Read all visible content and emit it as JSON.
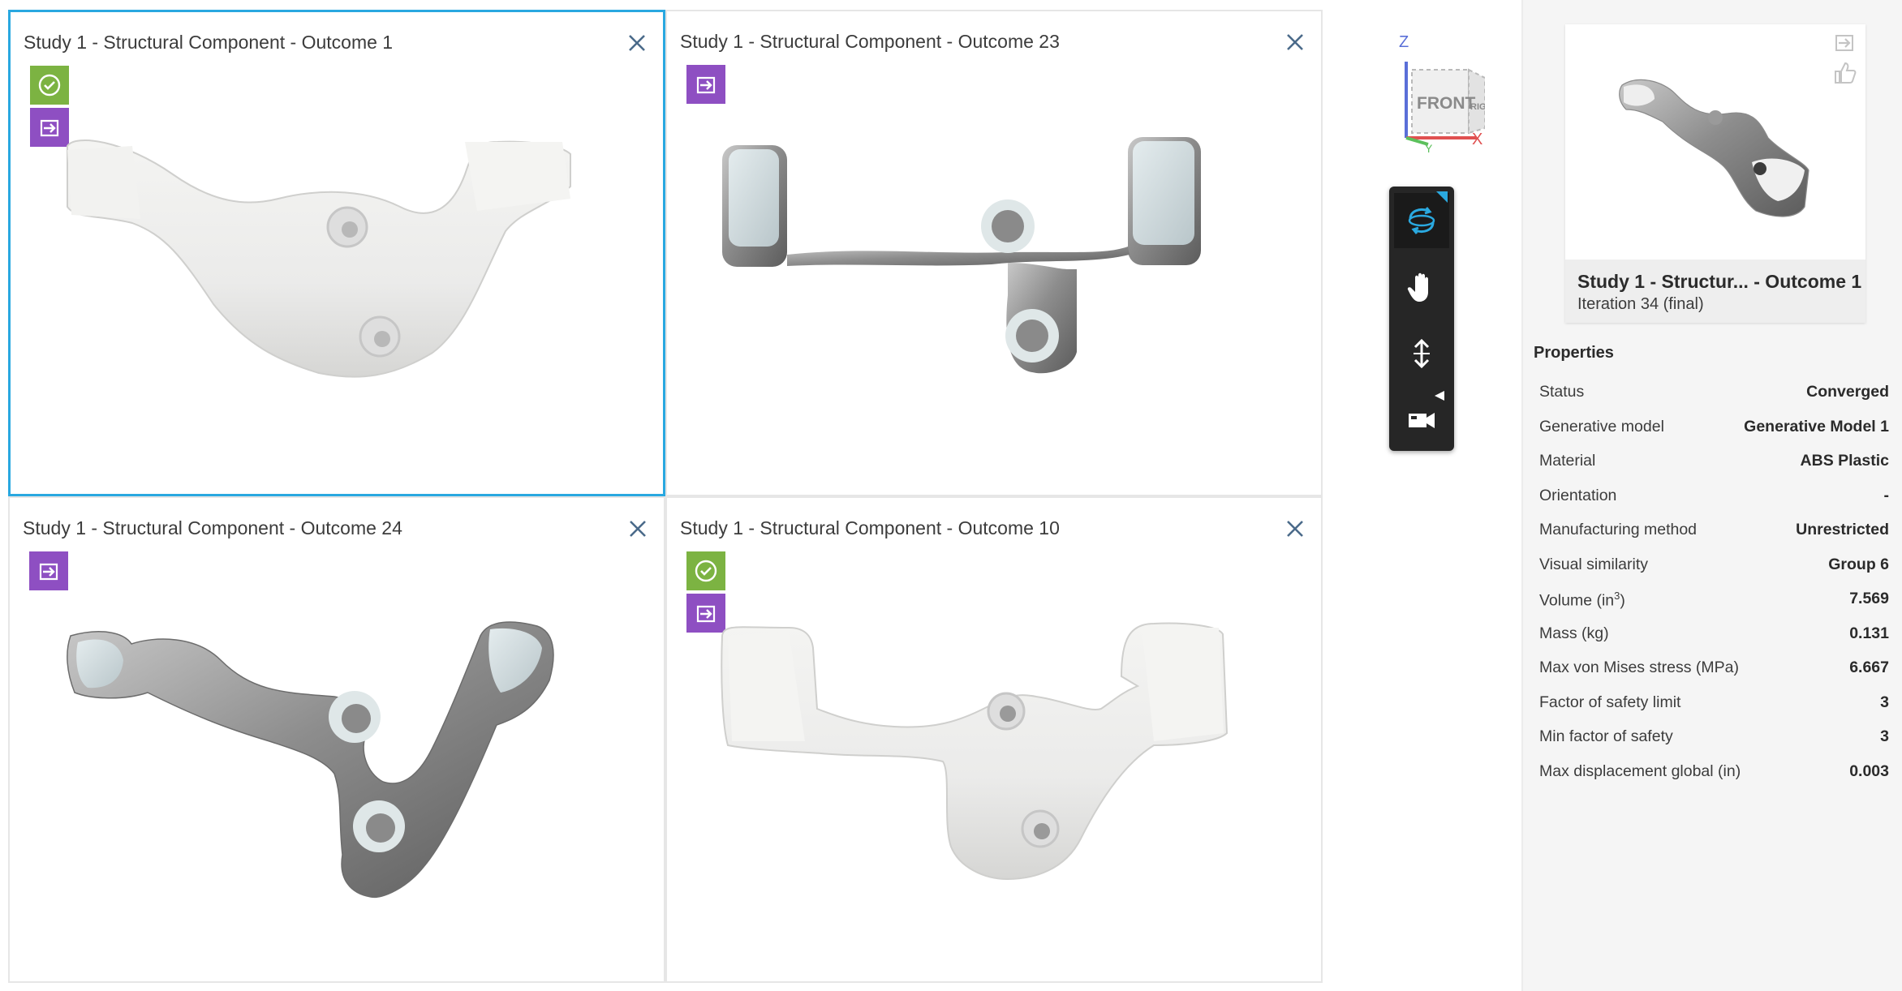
{
  "viewports": [
    {
      "title": "Study 1 - Structural Component - Outcome 1",
      "selected": true,
      "badges": [
        "check",
        "export"
      ]
    },
    {
      "title": "Study 1 - Structural Component - Outcome 23",
      "selected": false,
      "badges": [
        "export"
      ]
    },
    {
      "title": "Study 1 - Structural Component - Outcome 24",
      "selected": false,
      "badges": [
        "export"
      ]
    },
    {
      "title": "Study 1 - Structural Component - Outcome 10",
      "selected": false,
      "badges": [
        "check",
        "export"
      ]
    }
  ],
  "viewcube": {
    "face_front": "FRONT",
    "face_right": "RIGHT",
    "axis_z": "Z",
    "axis_x": "X",
    "axis_y": "Y"
  },
  "nav_tools": [
    "orbit-icon",
    "pan-icon",
    "zoom-icon",
    "camera-icon"
  ],
  "card": {
    "title": "Study 1 - Structur... - Outcome 1",
    "subtitle": "Iteration 34 (final)"
  },
  "properties": {
    "heading": "Properties",
    "rows": [
      {
        "label": "Status",
        "value": "Converged"
      },
      {
        "label": "Generative model",
        "value": "Generative Model 1"
      },
      {
        "label": "Material",
        "value": "ABS Plastic"
      },
      {
        "label": "Orientation",
        "value": "-"
      },
      {
        "label": "Manufacturing method",
        "value": "Unrestricted"
      },
      {
        "label": "Visual similarity",
        "value": "Group 6"
      },
      {
        "label": "Volume (in",
        "label_sup": "3",
        "label_tail": ")",
        "value": "7.569"
      },
      {
        "label": "Mass (kg)",
        "value": "0.131"
      },
      {
        "label": "Max von Mises stress (MPa)",
        "value": "6.667"
      },
      {
        "label": "Factor of safety limit",
        "value": "3"
      },
      {
        "label": "Min factor of safety",
        "value": "3"
      },
      {
        "label": "Max displacement global (in)",
        "value": "0.003"
      }
    ]
  },
  "colors": {
    "selected_border": "#29a8e0",
    "check_badge": "#7cb342",
    "export_badge": "#8e4fc2",
    "nav_active": "#2aa9e0"
  }
}
